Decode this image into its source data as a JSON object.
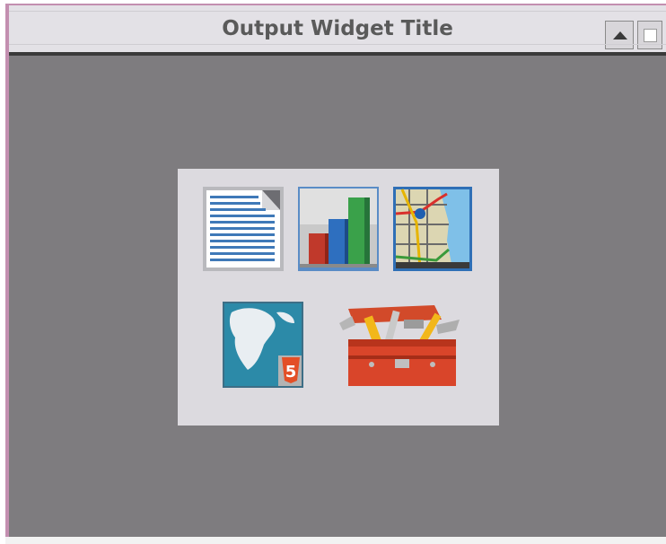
{
  "window": {
    "title": "Output Widget Title",
    "controls": [
      "collapse-button",
      "maximize-button"
    ]
  },
  "icons": [
    {
      "name": "document-icon",
      "label": ""
    },
    {
      "name": "chart-icon",
      "label": ""
    },
    {
      "name": "map-icon",
      "label": ""
    },
    {
      "name": "html5-globe-icon",
      "label": "5"
    },
    {
      "name": "toolbox-icon",
      "label": ""
    }
  ],
  "colors": {
    "frame_accent": "#c38fb0",
    "titlebar_bg": "#e3e1e6",
    "body_bg": "#7e7c7f",
    "panel_bg": "#dcdadf"
  }
}
